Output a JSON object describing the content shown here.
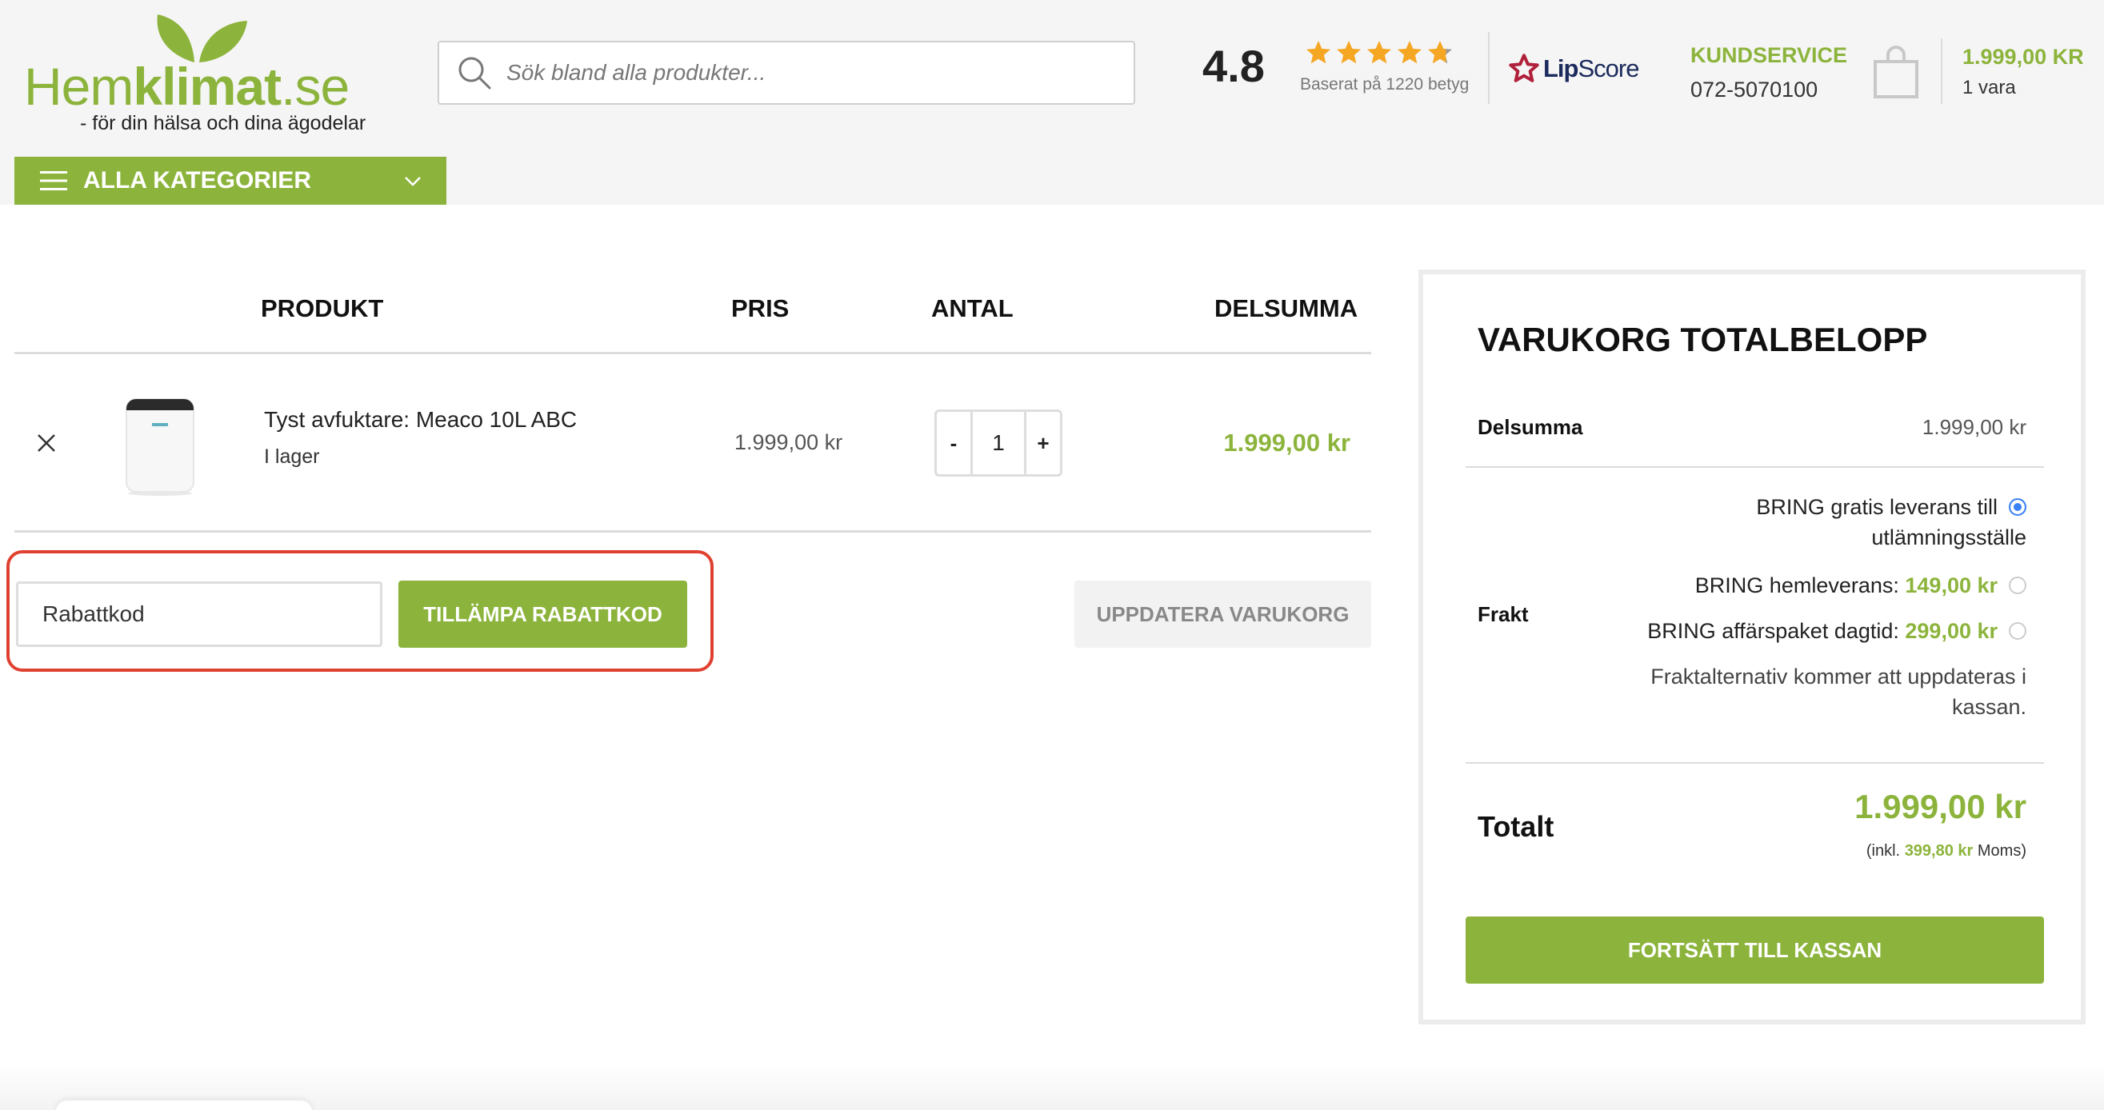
{
  "brand": {
    "name_part1": "Hem",
    "name_part2": "klimat",
    "name_part3": ".se",
    "tagline": "- för din hälsa och dina ägodelar",
    "color": "#8cb43c"
  },
  "search": {
    "placeholder": "Sök bland alla produkter...",
    "icon": "search-icon"
  },
  "rating": {
    "score": "4.8",
    "stars": 4.8,
    "based_on": "Baserat på 1220 betyg",
    "provider_part1": "Lip",
    "provider_part2": "Score"
  },
  "service": {
    "label": "KUNDSERVICE",
    "phone": "072-5070100"
  },
  "mini_cart": {
    "total": "1.999,00 KR",
    "count": "1 vara",
    "icon": "shopping-bag-icon"
  },
  "categories": {
    "label": "ALLA KATEGORIER"
  },
  "cart": {
    "headers": {
      "product": "PRODUKT",
      "price": "PRIS",
      "quantity": "ANTAL",
      "subtotal": "DELSUMMA"
    },
    "items": [
      {
        "name": "Tyst avfuktare: Meaco 10L ABC",
        "stock": "I lager",
        "price": "1.999,00 kr",
        "quantity": "1",
        "subtotal": "1.999,00 kr"
      }
    ],
    "qty_minus": "-",
    "qty_plus": "+",
    "coupon_placeholder": "Rabattkod",
    "apply_coupon": "TILLÄMPA RABATTKOD",
    "update_cart": "UPPDATERA VARUKORG"
  },
  "totals": {
    "title": "VARUKORG TOTALBELOPP",
    "subtotal_label": "Delsumma",
    "subtotal_value": "1.999,00 kr",
    "shipping_label": "Frakt",
    "shipping_options": [
      {
        "label_a": "BRING gratis leverans till",
        "label_b": "utlämningsställe",
        "amount": "",
        "selected": true
      },
      {
        "label_a": "BRING hemleverans: ",
        "label_b": "",
        "amount": "149,00 kr",
        "selected": false
      },
      {
        "label_a": "BRING affärspaket dagtid: ",
        "label_b": "",
        "amount": "299,00 kr",
        "selected": false
      }
    ],
    "shipping_note": "Fraktalternativ kommer att uppdateras i kassan.",
    "total_label": "Totalt",
    "total_value": "1.999,00 kr",
    "tax_prefix": "(inkl. ",
    "tax_amount": "399,80 kr",
    "tax_suffix": " Moms)",
    "checkout": "FORTSÄTT TILL KASSAN"
  }
}
